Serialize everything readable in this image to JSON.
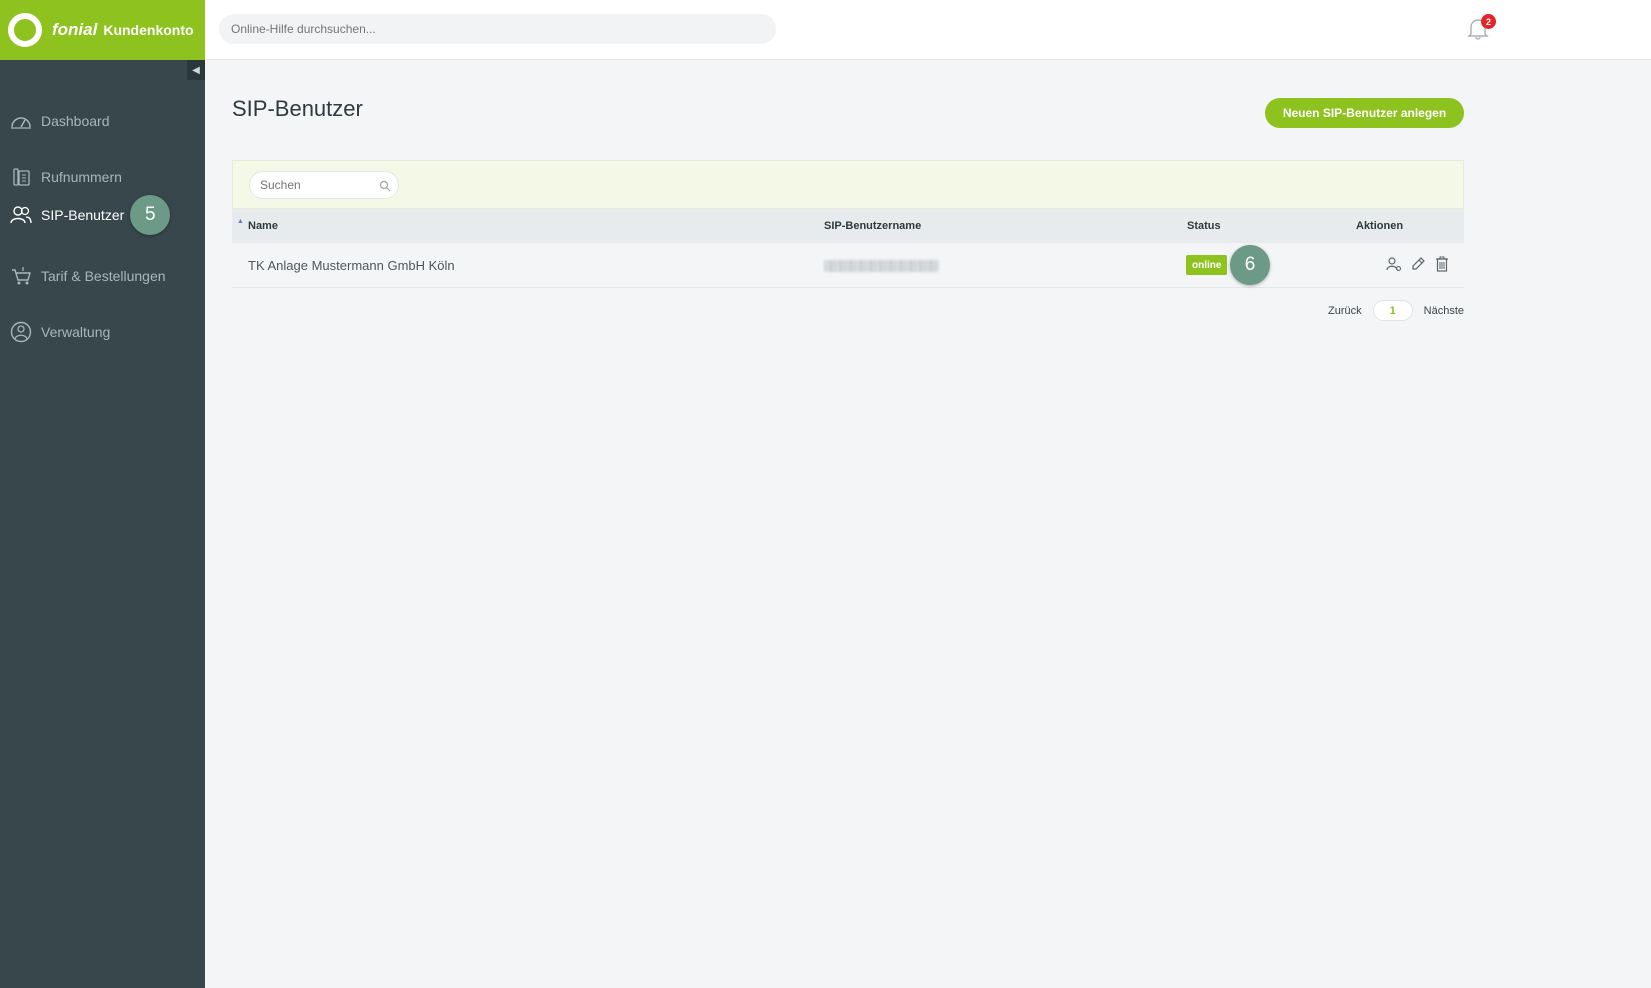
{
  "brand": {
    "name": "fonial",
    "subtitle": "Kundenkonto",
    "accent": "#8dc21f"
  },
  "topbar": {
    "search_placeholder": "Online-Hilfe durchsuchen...",
    "notifications_count": "2"
  },
  "sidebar": {
    "collapse_label": "◀",
    "items": [
      {
        "label": "Dashboard",
        "icon": "speedometer-icon"
      },
      {
        "label": "Rufnummern",
        "icon": "phone-book-icon"
      },
      {
        "label": "SIP-Benutzer",
        "icon": "users-icon",
        "active": true,
        "step": "5"
      },
      {
        "label": "Tarif & Bestellungen",
        "icon": "cart-icon"
      },
      {
        "label": "Verwaltung",
        "icon": "user-circle-icon"
      }
    ]
  },
  "main": {
    "title": "SIP-Benutzer",
    "add_button": "Neuen SIP-Benutzer anlegen",
    "search_placeholder": "Suchen",
    "columns": {
      "name": "Name",
      "username": "SIP-Benutzername",
      "status": "Status",
      "actions": "Aktionen"
    },
    "rows": [
      {
        "name": "TK Anlage Mustermann GmbH Köln",
        "status": "online",
        "step": "6"
      }
    ],
    "pagination": {
      "prev": "Zurück",
      "page": "1",
      "next": "Nächste"
    }
  }
}
